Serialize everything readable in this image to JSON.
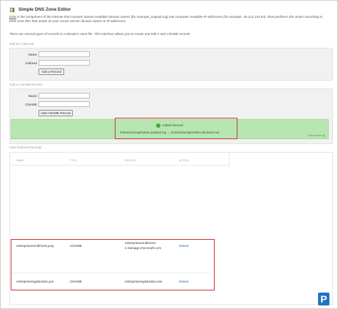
{
  "page": {
    "title": "Simple DNS Zone Editor",
    "intro_dns": "DNS",
    "intro_text": " is the component of the Internet that converts human-readable domain names (for example, prajwal.org) into computer-readable IP addresses (for example, 35.213.143.63). DNS performs this action according to DNS zone files that reside on your server and tie domain names to IP addresses.",
    "intro_text2": "There are several types of records in a domain's zone file. This interface allows you to create and edit A and CNAME records."
  },
  "a_record": {
    "section_label": "Add an A Record",
    "name_label": "Name",
    "address_label": "Address",
    "button": "Add a Record"
  },
  "cname_record": {
    "section_label": "Add a CNAME Record",
    "name_label": "Name",
    "cname_label": "CNAME",
    "button": "Add CNAME Record"
  },
  "notice": {
    "title": "Added Record",
    "detail": "Enterpriseregistration.prajwal.org → Enterpriseregistration.windows.net",
    "close": "Click to close. [5]",
    "color": "#b8e6b0"
  },
  "records": {
    "section_label": "User-Defined Records",
    "columns": [
      "NAME",
      "TYPE",
      "RECORD",
      "ACTION"
    ],
    "rows": [
      {
        "name": "enterpriseenrollment.praj",
        "type": "CNAME",
        "record_line1": "enterpriseenrollment-",
        "record_line2": "s.manage.microsoft.com",
        "action": "Delete"
      },
      {
        "name": "enterpriseregistration.pra",
        "type": "CNAME",
        "record_line1": "enterpriseregistration.win",
        "record_line2": "",
        "action": "Delete"
      }
    ]
  },
  "colors": {
    "highlight": "#cc3333",
    "link": "#2266bb",
    "logo": "#1f73c7"
  }
}
